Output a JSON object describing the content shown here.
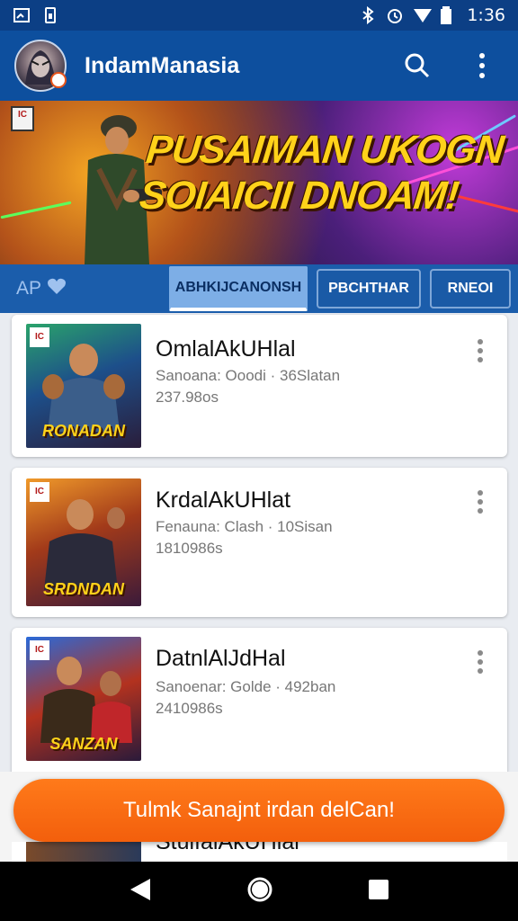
{
  "status_bar": {
    "time": "1:36",
    "icons": [
      "screenshot-icon",
      "battery-saver-icon",
      "bluetooth-icon",
      "alarm-icon",
      "signal-icon",
      "battery-icon"
    ]
  },
  "app_bar": {
    "title": "IndamManasia",
    "icons": [
      "avatar",
      "search-icon",
      "more-vert-icon"
    ]
  },
  "banner": {
    "rating": "IC",
    "headline_line1": "PUSAIMAN UKOGN",
    "headline_line2": "SOIAICII DNOAM!"
  },
  "tab_strip": {
    "label": "AP",
    "tabs": [
      {
        "label": "ABHKIJCANONSH",
        "active": true
      },
      {
        "label": "PBCHTHAR",
        "active": false
      },
      {
        "label": "RNEOI",
        "active": false
      }
    ]
  },
  "list": {
    "items": [
      {
        "title": "OmlalAkUHlal",
        "subtitle": "Sanoana: Ooodi · 36Slatan",
        "meta": "237.98os",
        "thumb_caption": "RONADAN",
        "thumb_rating": "IC"
      },
      {
        "title": "KrdalAkUHlat",
        "subtitle": "Fenauna: Clash · 10Sisan",
        "meta": "1810986s",
        "thumb_caption": "SRDNDAN",
        "thumb_rating": "IC"
      },
      {
        "title": "DatnlAlJdHal",
        "subtitle": "Sanoenar: Golde · 492ban",
        "meta": "2410986s",
        "thumb_caption": "SANZAN",
        "thumb_rating": "IC"
      }
    ],
    "peek_title": "StulfalAkUHlal"
  },
  "cta": {
    "label": "Tulmk Sanajnt irdan delCan!"
  },
  "nav_bar": {
    "icons": [
      "back-icon",
      "home-icon",
      "recents-icon"
    ]
  },
  "colors": {
    "app_bar": "#0d4f9e",
    "status_bar": "#0c3f85",
    "tab_strip": "#1b5dab",
    "cta": "#f35f0c",
    "headline": "#ffd21a"
  }
}
